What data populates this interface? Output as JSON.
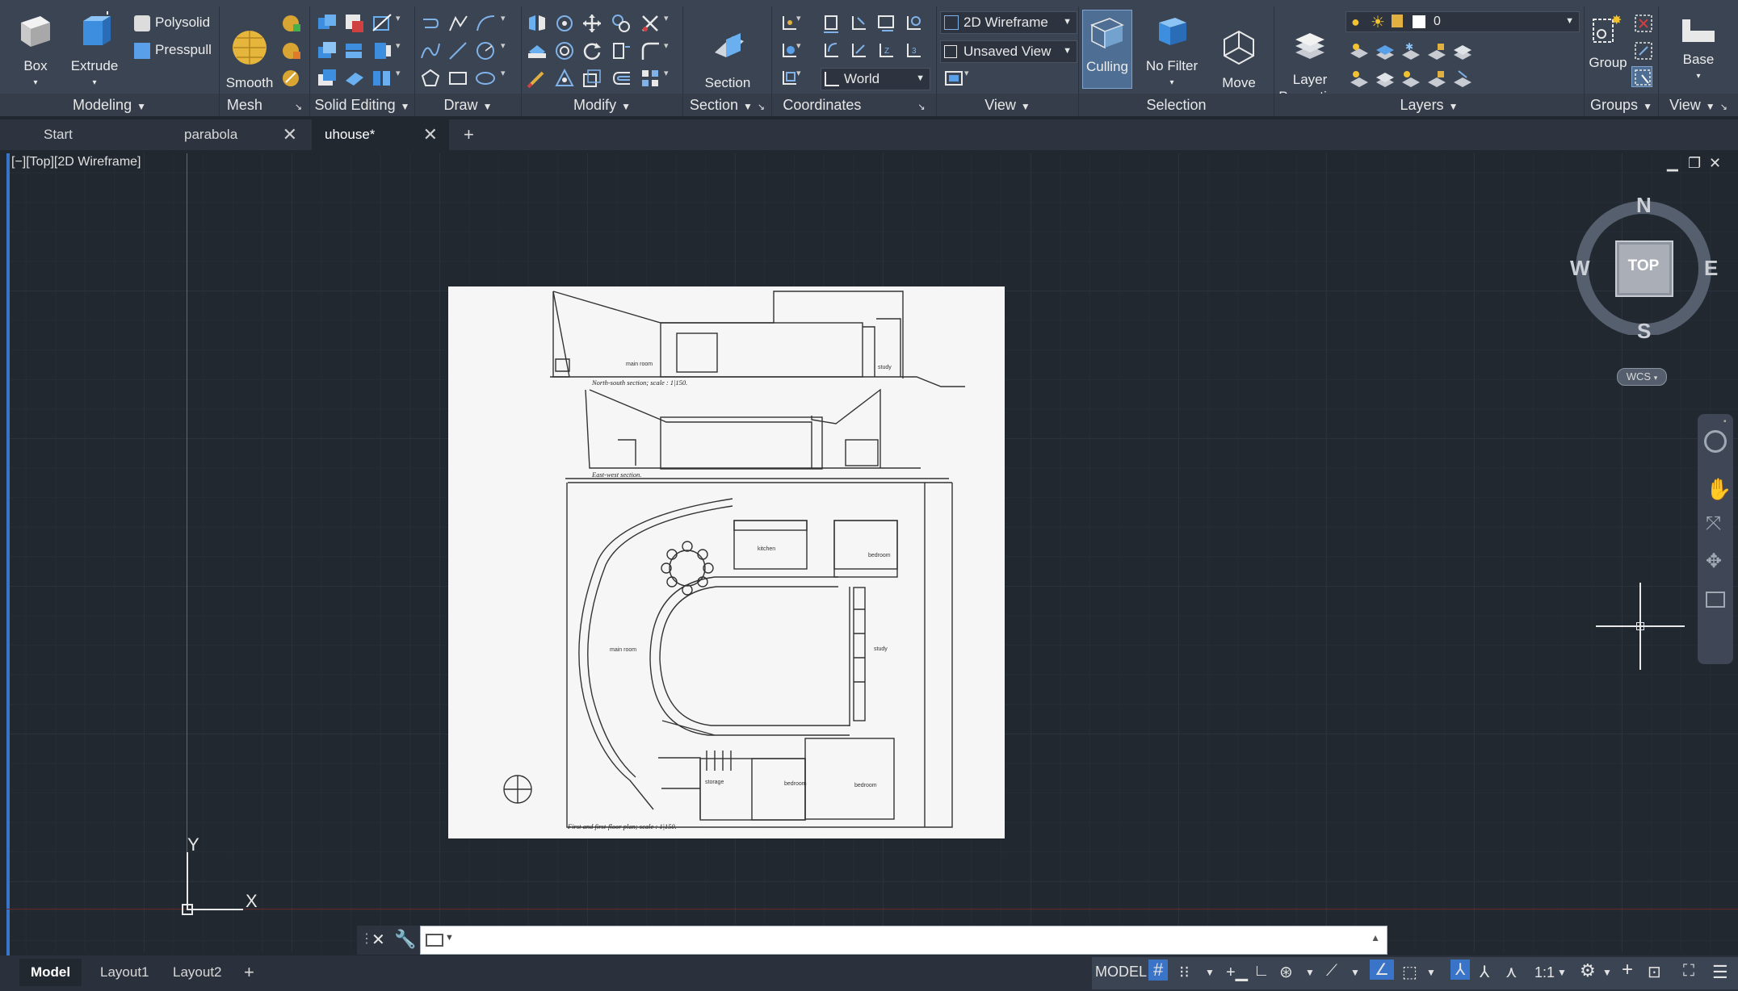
{
  "ribbon": {
    "modeling": {
      "title": "Modeling",
      "box": "Box",
      "extrude": "Extrude",
      "polysolid": "Polysolid",
      "presspull": "Presspull"
    },
    "mesh": {
      "title": "Mesh",
      "smooth_object": "Smooth\nObject"
    },
    "solid_editing": {
      "title": "Solid Editing"
    },
    "draw": {
      "title": "Draw"
    },
    "modify": {
      "title": "Modify"
    },
    "section": {
      "title": "Section",
      "section_plane": "Section\nPlane"
    },
    "coordinates": {
      "title": "Coordinates",
      "world": "World"
    },
    "view": {
      "title": "View",
      "visual_style": "2D Wireframe",
      "named_view": "Unsaved View"
    },
    "selection": {
      "title": "Selection",
      "culling": "Culling",
      "no_filter": "No Filter",
      "move_gizmo": "Move\nGizmo"
    },
    "layers": {
      "title": "Layers",
      "layer_properties": "Layer\nProperties",
      "current_layer": "0"
    },
    "groups": {
      "title": "Groups",
      "group": "Group"
    },
    "view2": {
      "title": "View",
      "base": "Base"
    }
  },
  "tabs": [
    {
      "label": "Start"
    },
    {
      "label": "parabola"
    },
    {
      "label": "uhouse*"
    }
  ],
  "viewport": {
    "label": "[−][Top][2D Wireframe]",
    "compass": {
      "n": "N",
      "s": "S",
      "e": "E",
      "w": "W",
      "face": "TOP"
    },
    "wcs": "WCS",
    "ucs_x": "X",
    "ucs_y": "Y"
  },
  "drawing": {
    "ns_section_caption": "North-south section; scale : 1|150.",
    "ew_section_caption": "East-west section.",
    "plan_caption": "First and first-floor plan; scale : 1|150.",
    "rooms": {
      "main_room_section": "main room",
      "study_section": "study",
      "kitchen": "kitchen",
      "bedroom_top": "bedroom",
      "main_room": "main room",
      "study": "study",
      "storage": "storage",
      "bedroom1": "bedroom",
      "bedroom2": "bedroom"
    }
  },
  "status": {
    "layout_tabs": [
      {
        "label": "Model"
      },
      {
        "label": "Layout1"
      },
      {
        "label": "Layout2"
      }
    ],
    "model_label": "MODEL",
    "scale": "1:1"
  },
  "colors": {
    "ribbon_bg": "#3b4453",
    "canvas_bg": "#212830",
    "accent": "#3a74c8",
    "ucs_y_axis": "#3a8a3a"
  }
}
